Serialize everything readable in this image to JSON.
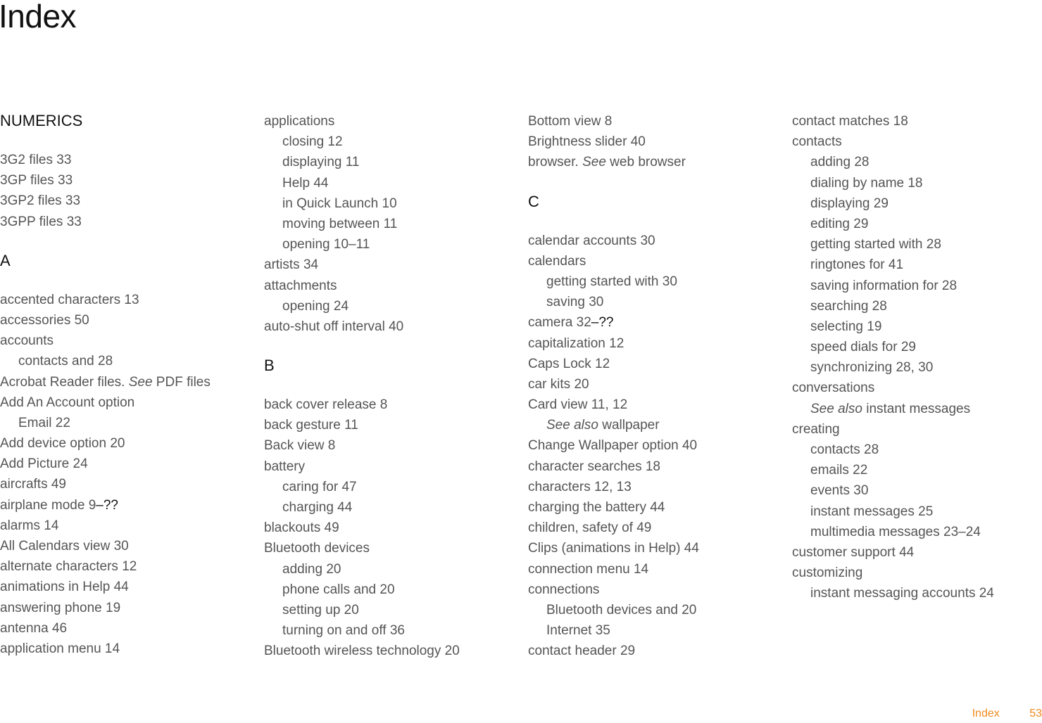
{
  "page": {
    "title": "Index",
    "footer": {
      "section": "Index",
      "page_number": "53"
    },
    "accent_color": "#ef8a1e"
  },
  "columns": [
    {
      "sections": [
        {
          "heading": "NUMERICS",
          "entries": [
            {
              "text": "3G2 files 33",
              "level": 0
            },
            {
              "text": "3GP files 33",
              "level": 0
            },
            {
              "text": "3GP2 files 33",
              "level": 0
            },
            {
              "text": "3GPP files 33",
              "level": 0
            }
          ]
        },
        {
          "heading": "A",
          "entries": [
            {
              "text": "accented characters 13",
              "level": 0
            },
            {
              "text": "accessories 50",
              "level": 0
            },
            {
              "text": "accounts",
              "level": 0
            },
            {
              "text": "contacts and 28",
              "level": 1
            },
            {
              "text": "Acrobat Reader files. ",
              "see": "See",
              "after": " PDF files",
              "level": 0
            },
            {
              "text": "Add An Account option",
              "level": 0
            },
            {
              "text": "Email 22",
              "level": 1
            },
            {
              "text": "Add device option 20",
              "level": 0
            },
            {
              "text": "Add Picture 24",
              "level": 0
            },
            {
              "text": "aircrafts 49",
              "level": 0
            },
            {
              "text": "airplane mode 9",
              "unresolved": "–??",
              "level": 0
            },
            {
              "text": "alarms 14",
              "level": 0
            },
            {
              "text": "All Calendars view 30",
              "level": 0
            },
            {
              "text": "alternate characters 12",
              "level": 0
            },
            {
              "text": "animations in Help 44",
              "level": 0
            },
            {
              "text": "answering phone 19",
              "level": 0
            },
            {
              "text": "antenna 46",
              "level": 0
            },
            {
              "text": "application menu 14",
              "level": 0
            }
          ]
        }
      ]
    },
    {
      "sections": [
        {
          "heading": null,
          "entries": [
            {
              "text": "applications",
              "level": 0
            },
            {
              "text": "closing 12",
              "level": 1
            },
            {
              "text": "displaying 11",
              "level": 1
            },
            {
              "text": "Help 44",
              "level": 1
            },
            {
              "text": "in Quick Launch 10",
              "level": 1
            },
            {
              "text": "moving between 11",
              "level": 1
            },
            {
              "text": "opening 10–11",
              "level": 1
            },
            {
              "text": "artists 34",
              "level": 0
            },
            {
              "text": "attachments",
              "level": 0
            },
            {
              "text": "opening 24",
              "level": 1
            },
            {
              "text": "auto-shut off interval 40",
              "level": 0
            }
          ]
        },
        {
          "heading": "B",
          "entries": [
            {
              "text": "back cover release 8",
              "level": 0
            },
            {
              "text": "back gesture 11",
              "level": 0
            },
            {
              "text": "Back view 8",
              "level": 0
            },
            {
              "text": "battery",
              "level": 0
            },
            {
              "text": "caring for 47",
              "level": 1
            },
            {
              "text": "charging 44",
              "level": 1
            },
            {
              "text": "blackouts 49",
              "level": 0
            },
            {
              "text": "Bluetooth devices",
              "level": 0
            },
            {
              "text": "adding 20",
              "level": 1
            },
            {
              "text": "phone calls and 20",
              "level": 1
            },
            {
              "text": "setting up 20",
              "level": 1
            },
            {
              "text": "turning on and off 36",
              "level": 1
            },
            {
              "text": "Bluetooth wireless technology 20",
              "level": 0
            }
          ]
        }
      ]
    },
    {
      "sections": [
        {
          "heading": null,
          "entries": [
            {
              "text": "Bottom view 8",
              "level": 0
            },
            {
              "text": "Brightness slider 40",
              "level": 0
            },
            {
              "text": "browser. ",
              "see": "See",
              "after": " web browser",
              "level": 0
            }
          ]
        },
        {
          "heading": "C",
          "entries": [
            {
              "text": "calendar accounts 30",
              "level": 0
            },
            {
              "text": "calendars",
              "level": 0
            },
            {
              "text": "getting started with 30",
              "level": 1
            },
            {
              "text": "saving 30",
              "level": 1
            },
            {
              "text": "camera 32",
              "unresolved": "–??",
              "level": 0
            },
            {
              "text": "capitalization 12",
              "level": 0
            },
            {
              "text": "Caps Lock 12",
              "level": 0
            },
            {
              "text": "car kits 20",
              "level": 0
            },
            {
              "text": "Card view 11, 12",
              "level": 0
            },
            {
              "text": "",
              "see": "See also",
              "after": " wallpaper",
              "level": 1
            },
            {
              "text": "Change Wallpaper option 40",
              "level": 0
            },
            {
              "text": "character searches 18",
              "level": 0
            },
            {
              "text": "characters 12, 13",
              "level": 0
            },
            {
              "text": "charging the battery 44",
              "level": 0
            },
            {
              "text": "children, safety of 49",
              "level": 0
            },
            {
              "text": "Clips (animations in Help) 44",
              "level": 0
            },
            {
              "text": "connection menu 14",
              "level": 0
            },
            {
              "text": "connections",
              "level": 0
            },
            {
              "text": "Bluetooth devices and 20",
              "level": 1
            },
            {
              "text": "Internet 35",
              "level": 1
            },
            {
              "text": "contact header 29",
              "level": 0
            }
          ]
        }
      ]
    },
    {
      "sections": [
        {
          "heading": null,
          "entries": [
            {
              "text": "contact matches 18",
              "level": 0
            },
            {
              "text": "contacts",
              "level": 0
            },
            {
              "text": "adding 28",
              "level": 1
            },
            {
              "text": "dialing by name 18",
              "level": 1
            },
            {
              "text": "displaying 29",
              "level": 1
            },
            {
              "text": "editing 29",
              "level": 1
            },
            {
              "text": "getting started with 28",
              "level": 1
            },
            {
              "text": "ringtones for 41",
              "level": 1
            },
            {
              "text": "saving information for 28",
              "level": 1
            },
            {
              "text": "searching 28",
              "level": 1
            },
            {
              "text": "selecting 19",
              "level": 1
            },
            {
              "text": "speed dials for 29",
              "level": 1
            },
            {
              "text": "synchronizing 28, 30",
              "level": 1
            },
            {
              "text": "conversations",
              "level": 0
            },
            {
              "text": "",
              "see": "See also",
              "after": " instant messages",
              "level": 1
            },
            {
              "text": "creating",
              "level": 0
            },
            {
              "text": "contacts 28",
              "level": 1
            },
            {
              "text": "emails 22",
              "level": 1
            },
            {
              "text": "events 30",
              "level": 1
            },
            {
              "text": "instant messages 25",
              "level": 1
            },
            {
              "text": "multimedia messages 23–24",
              "level": 1
            },
            {
              "text": "customer support 44",
              "level": 0
            },
            {
              "text": "customizing",
              "level": 0
            },
            {
              "text": "instant messaging accounts 24",
              "level": 1
            }
          ]
        }
      ]
    }
  ]
}
